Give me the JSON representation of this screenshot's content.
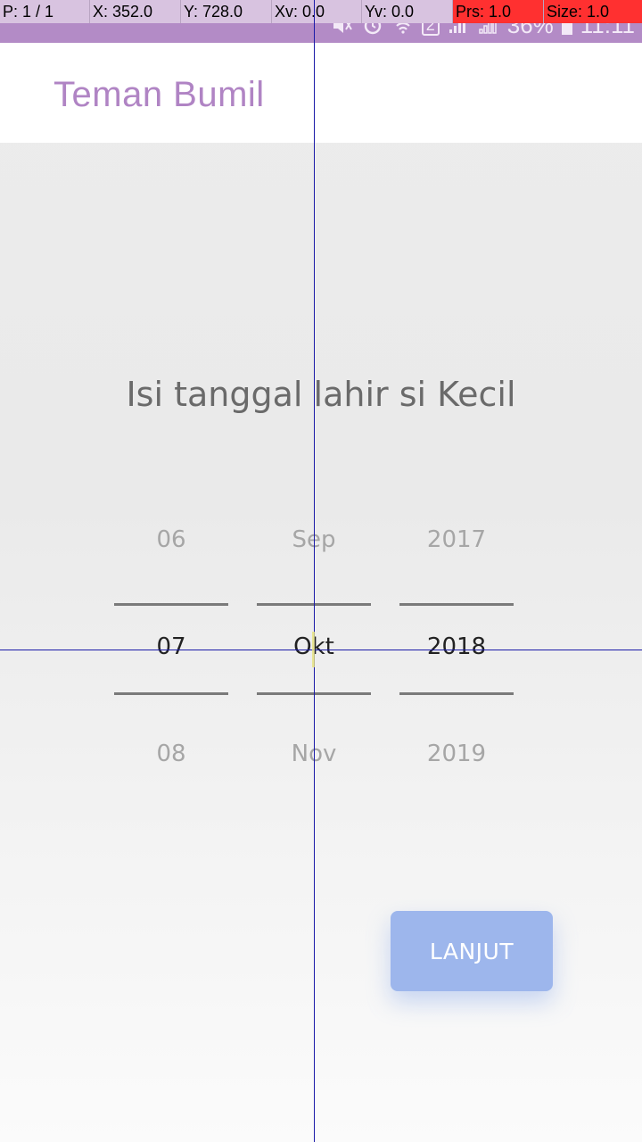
{
  "debug": {
    "pointer": "P: 1 / 1",
    "x": "X: 352.0",
    "y": "Y: 728.0",
    "xv": "Xv: 0.0",
    "yv": "Yv: 0.0",
    "prs": "Prs: 1.0",
    "size": "Size: 1.0"
  },
  "statusbar": {
    "sim_badge": "2",
    "battery": "36%",
    "time": "11:11",
    "icons": [
      "mute-icon",
      "alarm-icon",
      "wifi-icon",
      "signal-icon",
      "signal-icon",
      "battery-icon"
    ]
  },
  "appbar": {
    "title": "Teman Bumil"
  },
  "main": {
    "heading": "Isi tanggal lahir si Kecil",
    "day": {
      "prev": "06",
      "selected": "07",
      "next": "08"
    },
    "month": {
      "prev": "Sep",
      "selected": "Okt",
      "next": "Nov"
    },
    "year": {
      "prev": "2017",
      "selected": "2018",
      "next": "2019"
    },
    "next_button": "LANJUT"
  },
  "colors": {
    "statusbar": "#b38bc6",
    "brand": "#b084c4",
    "button": "#9db6ec",
    "crosshair": "#1a1aa8"
  }
}
